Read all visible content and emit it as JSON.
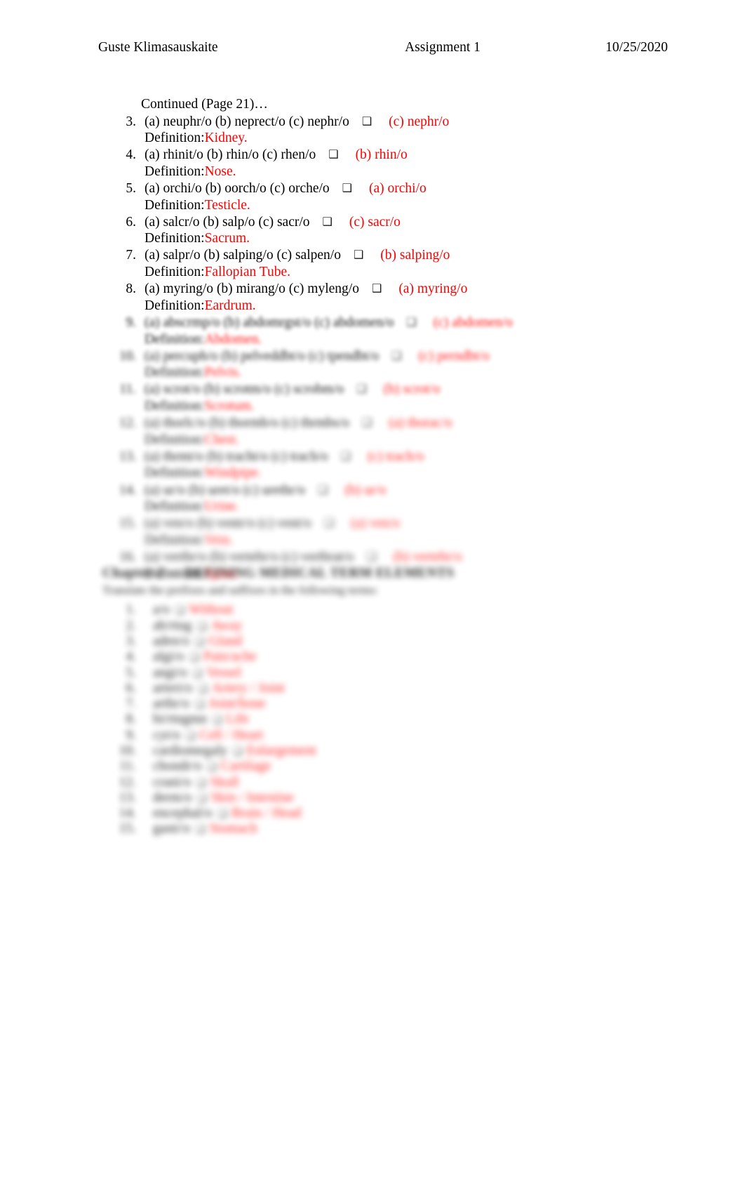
{
  "header": {
    "student_name": "Guste Klimasauskaite",
    "assignment_title": "Assignment 1",
    "date": "10/25/2020"
  },
  "document": {
    "continued_note": "Continued (Page 21)…",
    "definition_label": "Definition:",
    "arrow_glyph": "❑",
    "answer_color": "#FF0000",
    "text_color": "#000000"
  },
  "questions": [
    {
      "number": "3.",
      "options": "(a) neuphr/o (b) neprect/o (c) nephr/o",
      "answer": "(c) nephr/o",
      "definition": "Kidney.",
      "blur": "none"
    },
    {
      "number": "4.",
      "options": "(a) rhinit/o (b) rhin/o (c) rhen/o",
      "answer": "(b) rhin/o",
      "definition": "Nose.",
      "blur": "none"
    },
    {
      "number": "5.",
      "options": "(a) orchi/o (b) oorch/o (c) orche/o",
      "answer": "(a) orchi/o",
      "definition": "Testicle.",
      "blur": "none"
    },
    {
      "number": "6.",
      "options": "(a) salcr/o (b) salp/o (c) sacr/o",
      "answer": "(c) sacr/o",
      "definition": "Sacrum.",
      "blur": "none"
    },
    {
      "number": "7.",
      "options": "(a) salpr/o (b) salping/o (c) salpen/o",
      "answer": "(b) salping/o",
      "definition": "Fallopian Tube.",
      "blur": "none"
    },
    {
      "number": "8.",
      "options": "(a) myring/o (b) mirang/o (c) myleng/o",
      "answer": "(a) myring/o",
      "definition": "Eardrum.",
      "blur": "none"
    },
    {
      "number": "9.",
      "options": "(a) abscrmp/o (b) abdomrgst/o (c) abdomen/o",
      "answer": "(c) abdomen/o",
      "definition": "Abdomen.",
      "blur": "blur-1"
    },
    {
      "number": "10.",
      "options": "(a) percuph/o (b) pelveddbt/o (c) tpendbt/o",
      "answer": "(c) perndbt/o",
      "definition": "Pelvis.",
      "blur": "blur-2"
    },
    {
      "number": "11.",
      "options": "(a) scrot/o (b) scrotm/o (c) scrobm/o",
      "answer": "(b) scrot/o",
      "definition": "Scrotum.",
      "blur": "blur-2"
    },
    {
      "number": "12.",
      "options": "(a) thorlc/o (b) thormb/o (c) thrmbs/o",
      "answer": "(a) thorac/o",
      "definition": "Chest.",
      "blur": "blur-3"
    },
    {
      "number": "13.",
      "options": "(a) thrmt/o (b) tracht/o (c) trach/o",
      "answer": "(c) trach/o",
      "definition": "Windpipe.",
      "blur": "blur-3"
    },
    {
      "number": "14.",
      "options": "(a) ur/o (b) uret/o (c) urethr/o",
      "answer": "(b) ur/o",
      "definition": "Urine.",
      "blur": "blur-3"
    },
    {
      "number": "15.",
      "options": "(a) ven/o (b) ventr/o (c) vent/o",
      "answer": "(a) ven/o",
      "definition": "Vein.",
      "blur": "blur-4"
    },
    {
      "number": "16.",
      "options": "(a) vertbr/o (b) vertebr/o (c) vertbrat/o",
      "answer": "(b) vertebr/o",
      "definition": "Spine.",
      "blur": "blur-4"
    }
  ],
  "section_two": {
    "title": "Chapter 2 — DEFINING MEDICAL TERM ELEMENTS",
    "subtitle": "Translate the prefixes and suffixes in the following terms:",
    "arrow_glyph": "❑",
    "items": [
      {
        "number": "1.",
        "term": "a/o",
        "answer": "Without",
        "blur": "blur-4"
      },
      {
        "number": "2.",
        "term": "ab/rtng",
        "answer": "Away",
        "blur": "blur-4"
      },
      {
        "number": "3.",
        "term": "aden/o",
        "answer": "Gland",
        "blur": "blur-4"
      },
      {
        "number": "4.",
        "term": "algi/o",
        "answer": "Pain/ache",
        "blur": "blur-4"
      },
      {
        "number": "5.",
        "term": "angi/o",
        "answer": "Vessel",
        "blur": "blur-4"
      },
      {
        "number": "6.",
        "term": "arteri/o",
        "answer": "Artery / Joint",
        "blur": "blur-4"
      },
      {
        "number": "7.",
        "term": "arthr/o",
        "answer": "Joint/bone",
        "blur": "blur-4"
      },
      {
        "number": "8.",
        "term": "bi/rtngmn",
        "answer": "Life",
        "blur": "blur-4"
      },
      {
        "number": "9.",
        "term": "cyt/o",
        "answer": "Cell / Heart",
        "blur": "blur-4"
      },
      {
        "number": "10.",
        "term": "cardiomegaly",
        "answer": "Enlargement",
        "blur": "blur-4"
      },
      {
        "number": "11.",
        "term": "chondr/o",
        "answer": "Cartilage",
        "blur": "blur-4"
      },
      {
        "number": "12.",
        "term": "crani/o",
        "answer": "Skull",
        "blur": "blur-4"
      },
      {
        "number": "13.",
        "term": "derm/o",
        "answer": "Skin / Intestine",
        "blur": "blur-4"
      },
      {
        "number": "14.",
        "term": "encephal/o",
        "answer": "Brain / Head",
        "blur": "blur-4"
      },
      {
        "number": "15.",
        "term": "gastr/o",
        "answer": "Stomach",
        "blur": "blur-4"
      }
    ]
  }
}
